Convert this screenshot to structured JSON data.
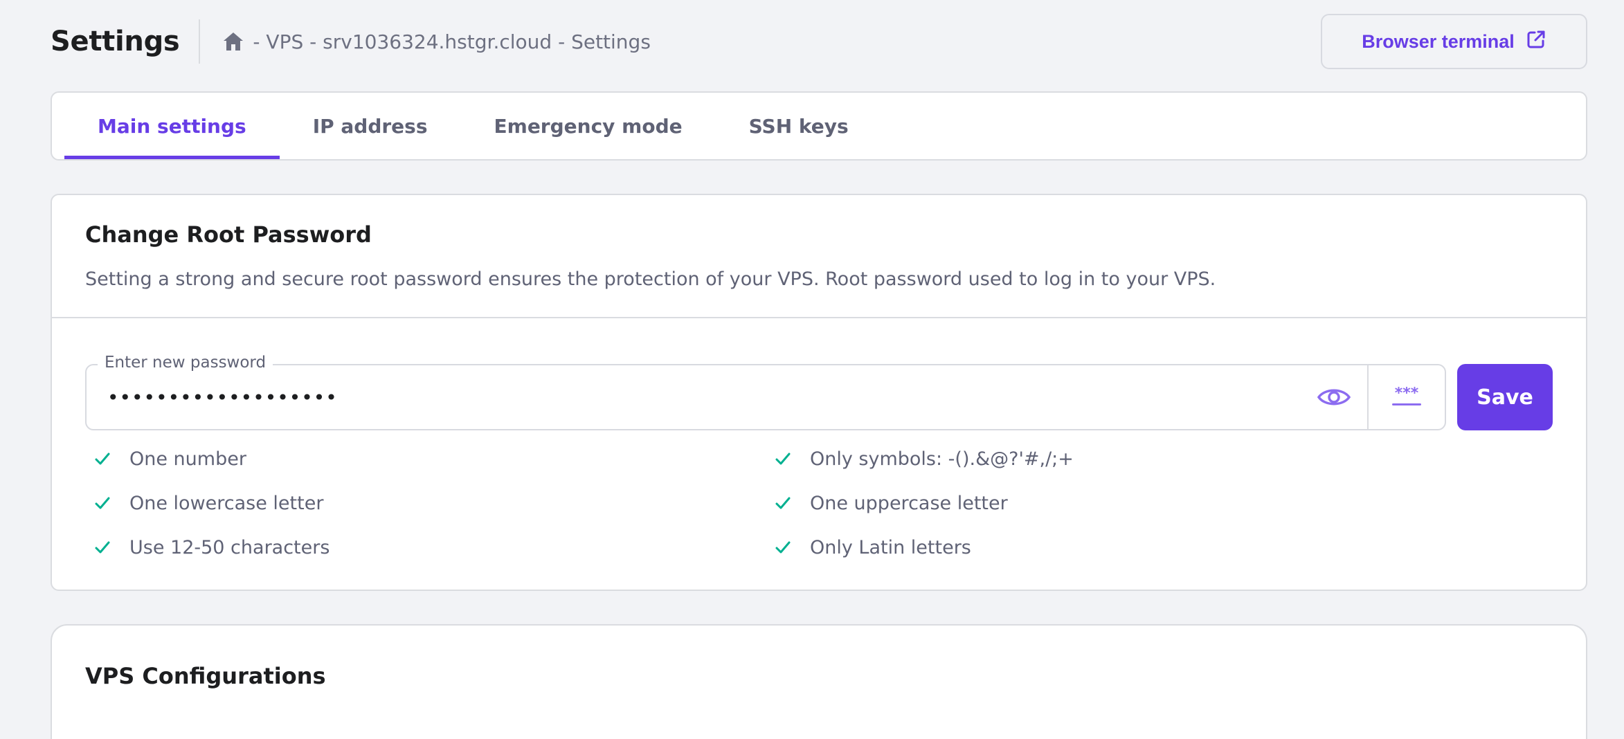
{
  "header": {
    "title": "Settings",
    "breadcrumb": "- VPS - srv1036324.hstgr.cloud - Settings",
    "browser_terminal_label": "Browser terminal"
  },
  "tabs": [
    {
      "label": "Main settings",
      "active": true
    },
    {
      "label": "IP address",
      "active": false
    },
    {
      "label": "Emergency mode",
      "active": false
    },
    {
      "label": "SSH keys",
      "active": false
    }
  ],
  "change_password": {
    "title": "Change Root Password",
    "description": "Setting a strong and secure root password ensures the protection of your VPS. Root password used to log in to your VPS.",
    "field_label": "Enter new password",
    "field_value": "•••••••••••••••••••",
    "generate_glyph": "***",
    "save_label": "Save",
    "requirements": [
      "One number",
      "Only symbols: -().&@?'#,/;+",
      "One lowercase letter",
      "One uppercase letter",
      "Use 12-50 characters",
      "Only Latin letters"
    ]
  },
  "vps_configurations": {
    "title": "VPS Configurations"
  },
  "colors": {
    "accent": "#673de6",
    "success": "#00b090",
    "text_muted": "#5f6275",
    "background": "#f2f3f6"
  },
  "icons": [
    "home-icon",
    "external-link-icon",
    "eye-icon",
    "generate-password-icon",
    "check-icon"
  ]
}
